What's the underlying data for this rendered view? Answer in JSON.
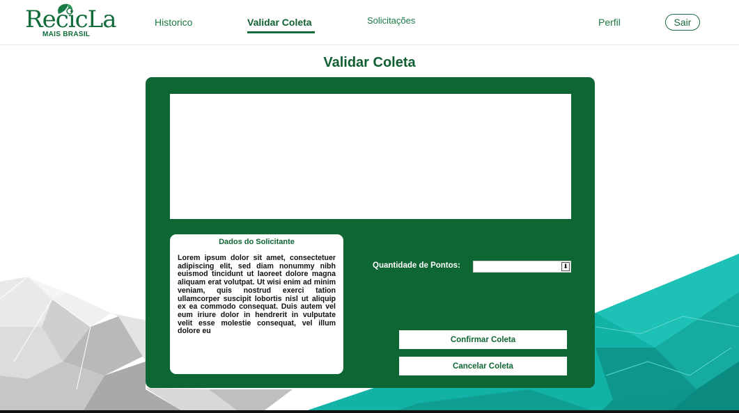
{
  "brand": {
    "name": "RecicLa",
    "subtitle": "MAIS BRASIL"
  },
  "nav": {
    "historico": "Historico",
    "validar": "Validar Coleta",
    "solicitacoes": "Solicitações",
    "perfil": "Perfil",
    "sair": "Sair"
  },
  "page": {
    "title": "Validar Coleta"
  },
  "solicitante": {
    "title": "Dados do Solicitante",
    "text": "Lorem ipsum dolor sit amet, consectetuer adipiscing elit, sed diam nonummy nibh euismod tincidunt ut laoreet dolore magna aliquam erat volutpat. Ut wisi enim ad minim veniam, quis nostrud exerci tation ullamcorper suscipit lobortis nisl ut aliquip ex ea commodo consequat. Duis autem vel eum iriure dolor in hendrerit in vulputate velit esse molestie consequat, vel illum dolore eu"
  },
  "form": {
    "points_label": "Quantidade de Pontos:",
    "points_value": "",
    "confirm_label": "Confirmar Coleta",
    "cancel_label": "Cancelar Coleta"
  },
  "colors": {
    "brand_green": "#0e6634",
    "accent_teal": "#14b3a8"
  },
  "icons": {
    "select_arrow": "arrow-down-icon",
    "logo_leaf": "leaf-icon"
  }
}
